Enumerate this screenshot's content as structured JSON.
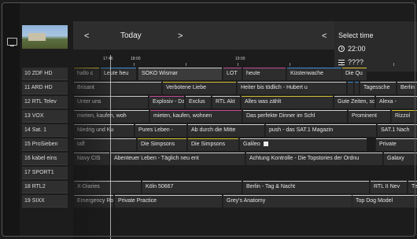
{
  "header": {
    "prev_label": "<",
    "next_label": ">",
    "date_label": "Today",
    "panel_prev_label": "<"
  },
  "select_time": {
    "title": "Select time",
    "time_value": "22:00",
    "extra_value": "????"
  },
  "timeline": {
    "now_label": "17:46",
    "labels": [
      "18:00",
      "19:00"
    ]
  },
  "colors": {
    "yellow": "#d9c534",
    "pink": "#c94a97",
    "blue": "#3c8fd6",
    "white": "#d0d0d0"
  },
  "channels": [
    {
      "label": "10 ZDF HD",
      "programs": [
        {
          "title": "hallo c",
          "color": "yellow"
        },
        {
          "title": "Leute heu",
          "color": "blue"
        },
        {
          "title": "SOKO Wismar",
          "color": "white",
          "hl": true
        },
        {
          "title": "LOT",
          "color": "pink"
        },
        {
          "title": "heute",
          "color": "pink"
        },
        {
          "title": "Küstenwache",
          "color": "blue"
        },
        {
          "title": "Die Qu",
          "color": "yellow"
        }
      ]
    },
    {
      "label": "11 ARD HD",
      "programs": [
        {
          "title": "Brisant",
          "color": "white"
        },
        {
          "title": "Verbotene Liebe",
          "color": "yellow"
        },
        {
          "title": "Heiter bis tödlich - Hubert u",
          "color": "white"
        },
        {
          "title": "",
          "color": "blue"
        },
        {
          "title": "",
          "color": "blue"
        },
        {
          "title": "Tagessche",
          "color": "white"
        },
        {
          "title": "Berlin",
          "color": "white"
        }
      ]
    },
    {
      "label": "12 RTL Telev",
      "programs": [
        {
          "title": "Unter uns",
          "color": "white"
        },
        {
          "title": "Explosiv - Das",
          "color": "pink"
        },
        {
          "title": "Exclus",
          "color": "white"
        },
        {
          "title": "RTL Akt",
          "color": "white"
        },
        {
          "title": "Alles was zählt",
          "color": "yellow"
        },
        {
          "title": "Gute Zeiten, schlec",
          "color": "white"
        },
        {
          "title": "Alexa -",
          "color": "white"
        }
      ]
    },
    {
      "label": "13 VOX",
      "programs": [
        {
          "title": "mieten, kaufen, woh",
          "color": "white"
        },
        {
          "title": "mieten, kaufen, wohnen",
          "color": "pink"
        },
        {
          "title": "Das perfekte Dinner im Schl",
          "color": "white"
        },
        {
          "title": "Prominent",
          "color": "white"
        },
        {
          "title": "Rizzol",
          "color": "yellow"
        }
      ]
    },
    {
      "label": "14 Sat. 1",
      "programs": [
        {
          "title": "Niedrig und Ku",
          "color": "white"
        },
        {
          "title": "Pures Leben -",
          "color": "white"
        },
        {
          "title": "Ab durch die Mitte",
          "color": "white"
        },
        {
          "title": "push - das SAT.1 Magazin",
          "color": "white"
        },
        {
          "title": "SAT.1 Nach",
          "color": "white"
        },
        {
          "title": "Das Mu",
          "color": "white"
        }
      ]
    },
    {
      "label": "15 ProSieben",
      "programs": [
        {
          "title": "taff",
          "color": "white"
        },
        {
          "title": "Die Simpsons",
          "color": "yellow"
        },
        {
          "title": "Die Simpsons",
          "color": "yellow"
        },
        {
          "title": "Galileo",
          "color": "white",
          "icon": true
        },
        {
          "title": "Private",
          "color": "white"
        }
      ]
    },
    {
      "label": "16 kabel eins",
      "programs": [
        {
          "title": "Navy CIS",
          "color": "white"
        },
        {
          "title": "Abenteuer Leben - Täglich neu ent",
          "color": "white"
        },
        {
          "title": "Achtung Kontrolle - Die Topstories der Ordnu",
          "color": "white"
        },
        {
          "title": "Galaxy",
          "color": "white"
        }
      ]
    },
    {
      "label": "17 SPORT1",
      "programs": []
    },
    {
      "label": "18 RTL2",
      "programs": [
        {
          "title": "X-Diaries",
          "color": "white"
        },
        {
          "title": "Köln 50667",
          "color": "white"
        },
        {
          "title": "Berlin - Tag & Nacht",
          "color": "white"
        },
        {
          "title": "RTL II Nev",
          "color": "white"
        },
        {
          "title": "Teenie",
          "color": "white"
        }
      ]
    },
    {
      "label": "19 SIXX",
      "programs": [
        {
          "title": "Emergency Room",
          "color": "white"
        },
        {
          "title": "Private Practice",
          "color": "white"
        },
        {
          "title": "Grey's Anatomy",
          "color": "white"
        },
        {
          "title": "Top Dog Model",
          "color": "white"
        }
      ]
    }
  ]
}
